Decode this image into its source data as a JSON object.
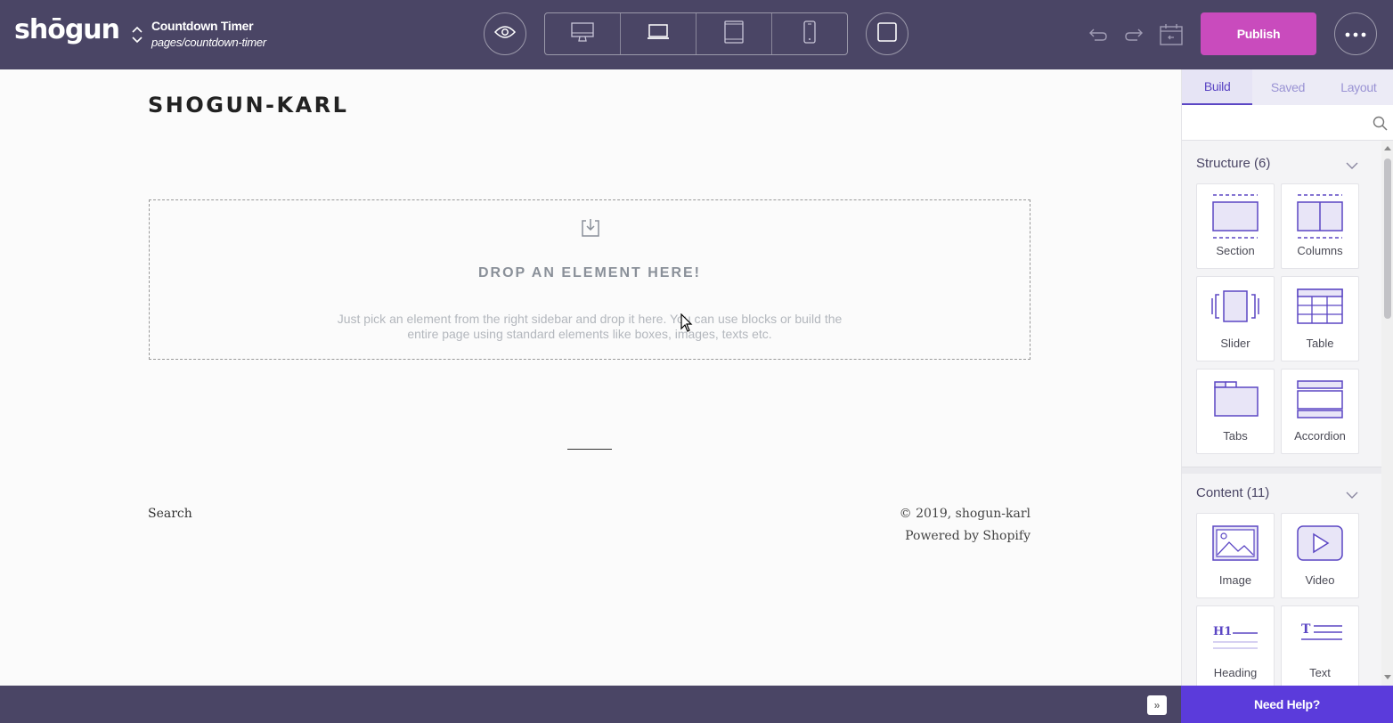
{
  "app": {
    "logo": "shōgun",
    "page_title": "Countdown Timer",
    "page_path": "pages/countdown-timer",
    "publish_label": "Publish",
    "help_label": "Need Help?",
    "collapse_label": "»"
  },
  "icons": {
    "preview": "eye-icon",
    "desktop": "desktop-icon",
    "laptop": "laptop-icon",
    "tablet": "tablet-icon",
    "mobile": "mobile-icon",
    "fullscreen": "square-icon",
    "undo": "undo-icon",
    "redo": "redo-icon",
    "schedule": "calendar-icon",
    "more": "more-icon"
  },
  "canvas": {
    "shop_name": "SHOGUN-KARL",
    "drop_title": "DROP AN ELEMENT HERE!",
    "drop_desc": "Just pick an element from the right sidebar and drop it here. You can use blocks or build the entire page using standard elements like boxes, images, texts etc.",
    "footer_search": "Search",
    "footer_copyright": "© 2019, shogun-karl",
    "footer_powered": "Powered by Shopify"
  },
  "sidebar": {
    "tabs": [
      {
        "label": "Build",
        "active": true
      },
      {
        "label": "Saved",
        "active": false
      },
      {
        "label": "Layout",
        "active": false
      }
    ],
    "search_placeholder": "",
    "structure": {
      "title": "Structure (6)",
      "items": [
        "Section",
        "Columns",
        "Slider",
        "Table",
        "Tabs",
        "Accordion"
      ]
    },
    "content": {
      "title": "Content (11)",
      "items": [
        "Image",
        "Video",
        "Heading",
        "Text"
      ]
    }
  },
  "colors": {
    "topbar": "#4a4565",
    "publish": "#c94bbd",
    "help": "#5b3bdb",
    "accent": "#5b46c4"
  }
}
